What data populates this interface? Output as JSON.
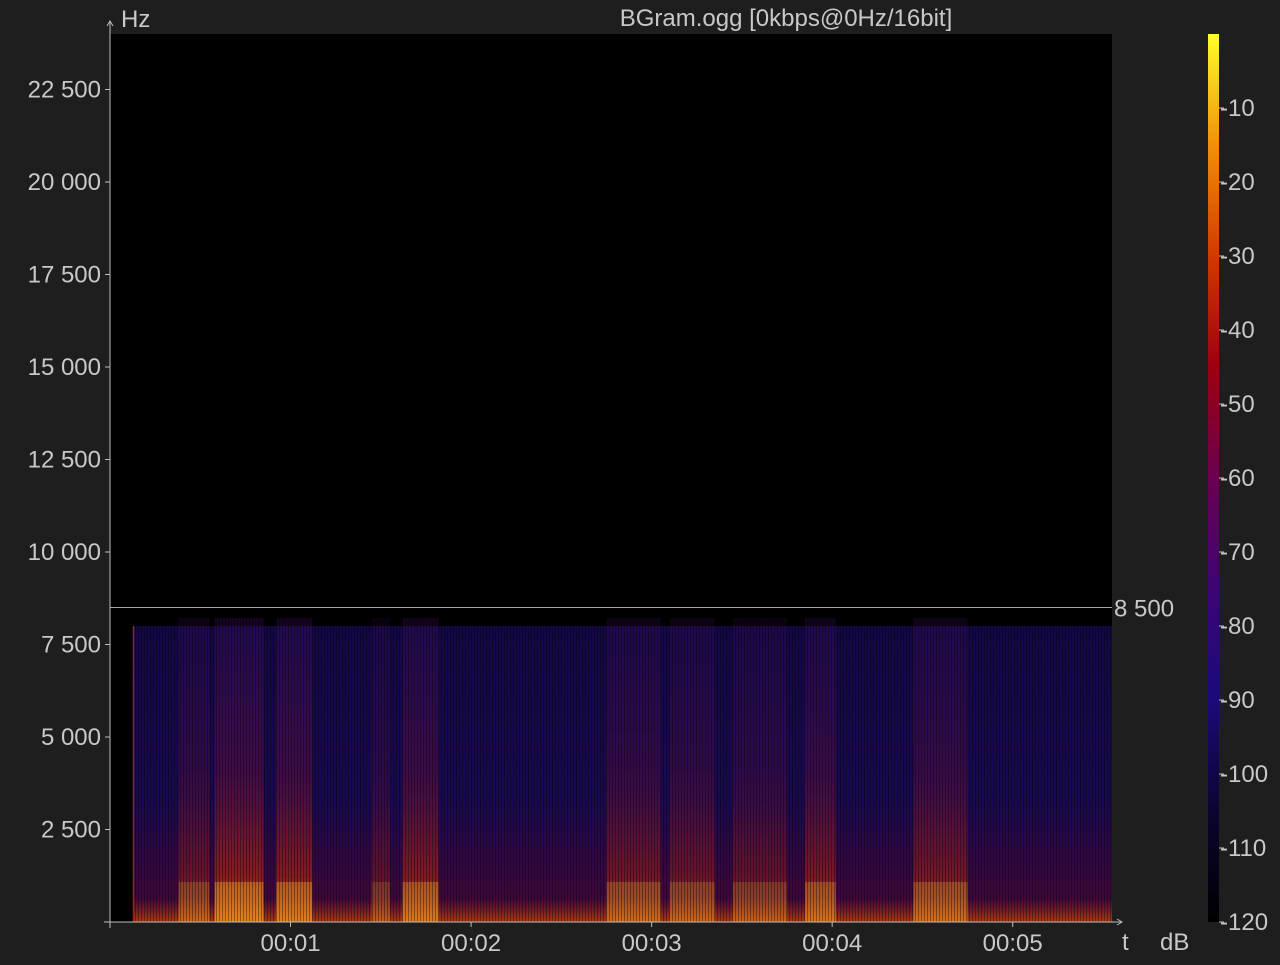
{
  "title": "BGram.ogg [0kbps@0Hz/16bit]",
  "colors": {
    "background": "#1e1e1e",
    "plot_background": "#000000",
    "text": "#c8c8c8",
    "axis": "#bdbdbd",
    "marker_line": "#a8a8a8",
    "colormap": [
      "#000000",
      "#0b0530",
      "#1a0a7a",
      "#3d0575",
      "#6a0050",
      "#9c0010",
      "#d13a00",
      "#f0900a",
      "#ffff28"
    ]
  },
  "chart_data": {
    "type": "heatmap",
    "title": "BGram.ogg [0kbps@0Hz/16bit]",
    "y_axis": {
      "unit_label": "Hz",
      "range": [
        0,
        24000
      ],
      "ticks": [
        2500,
        5000,
        7500,
        10000,
        12500,
        15000,
        17500,
        20000,
        22500
      ],
      "tick_labels": [
        "2 500",
        "5 000",
        "7 500",
        "10 000",
        "12 500",
        "15 000",
        "17 500",
        "20 000",
        "22 500"
      ]
    },
    "x_axis": {
      "unit_label": "t",
      "range_seconds": [
        0,
        5.55
      ],
      "ticks_seconds": [
        1,
        2,
        3,
        4,
        5
      ],
      "tick_labels": [
        "00:01",
        "00:02",
        "00:03",
        "00:04",
        "00:05"
      ]
    },
    "colorbar": {
      "unit_label": "dB",
      "range": [
        -120,
        0
      ],
      "ticks": [
        -10,
        -20,
        -30,
        -40,
        -50,
        -60,
        -70,
        -80,
        -90,
        -100,
        -110,
        -120
      ],
      "tick_labels": [
        "-10",
        "-20",
        "-30",
        "-40",
        "-50",
        "-60",
        "-70",
        "-80",
        "-90",
        "-100",
        "-110",
        "-120"
      ]
    },
    "cutoff_marker": {
      "frequency_hz": 8500,
      "label": "8 500"
    },
    "audio_start_seconds": 0.13,
    "content_max_frequency_hz": 8000,
    "energy_segments": [
      {
        "start": 0.38,
        "end": 0.55,
        "level_db": -55
      },
      {
        "start": 0.58,
        "end": 0.85,
        "level_db": -40
      },
      {
        "start": 0.92,
        "end": 1.12,
        "level_db": -42
      },
      {
        "start": 1.45,
        "end": 1.55,
        "level_db": -60
      },
      {
        "start": 1.62,
        "end": 1.82,
        "level_db": -45
      },
      {
        "start": 2.75,
        "end": 3.05,
        "level_db": -52
      },
      {
        "start": 3.1,
        "end": 3.35,
        "level_db": -55
      },
      {
        "start": 3.45,
        "end": 3.75,
        "level_db": -58
      },
      {
        "start": 3.85,
        "end": 4.02,
        "level_db": -48
      },
      {
        "start": 4.45,
        "end": 4.75,
        "level_db": -50
      }
    ]
  }
}
